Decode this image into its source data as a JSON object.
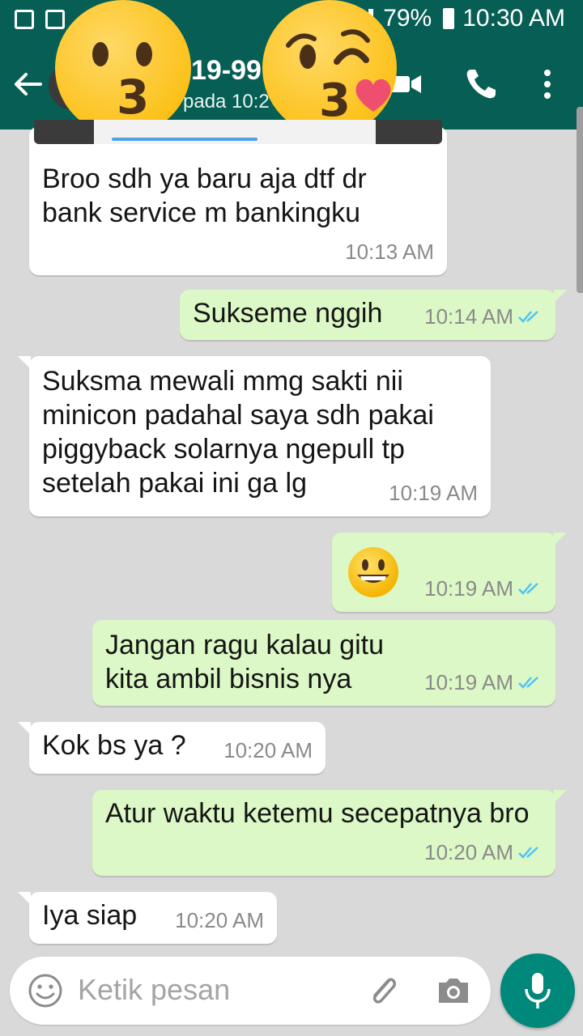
{
  "status_bar": {
    "battery": "79%",
    "time": "10:30 AM"
  },
  "chat_header": {
    "title": "19-99",
    "subtitle": "pada 10:2"
  },
  "icons": [
    "back-arrow-icon",
    "video-call-icon",
    "phone-icon",
    "more-options-icon",
    "emoji-icon",
    "attachment-icon",
    "camera-icon",
    "mic-icon",
    "kiss-emoji-icon",
    "blowing-kiss-emoji-icon",
    "grinning-emoji-icon",
    "double-check-icon"
  ],
  "colors": {
    "header": "#075e54",
    "outgoing_bubble": "#dcf8c6",
    "incoming_bubble": "#ffffff",
    "chat_background": "#d9d9d9",
    "read_ticks": "#4fc3f7",
    "mic_button": "#00897b"
  },
  "messages": [
    {
      "direction": "in",
      "text": "Broo sdh ya baru aja dtf dr bank service m bankingku",
      "time": "10:13 AM"
    },
    {
      "direction": "out",
      "text": "Sukseme nggih",
      "time": "10:14 AM",
      "read": true
    },
    {
      "direction": "in",
      "text": "Suksma mewali mmg sakti nii minicon padahal saya sdh pakai piggyback solarnya ngepull tp setelah pakai ini ga lg",
      "time": "10:19 AM"
    },
    {
      "direction": "out",
      "text": "😀",
      "time": "10:19 AM",
      "read": true
    },
    {
      "direction": "out",
      "text": "Jangan ragu kalau gitu kita ambil bisnis nya",
      "time": "10:19 AM",
      "read": true
    },
    {
      "direction": "in",
      "text": "Kok bs ya ?",
      "time": "10:20 AM"
    },
    {
      "direction": "out",
      "text": "Atur waktu ketemu secepatnya bro",
      "time": "10:20 AM",
      "read": true
    },
    {
      "direction": "in",
      "text": "Iya siap",
      "time": "10:20 AM"
    }
  ],
  "composer": {
    "placeholder": "Ketik pesan"
  }
}
